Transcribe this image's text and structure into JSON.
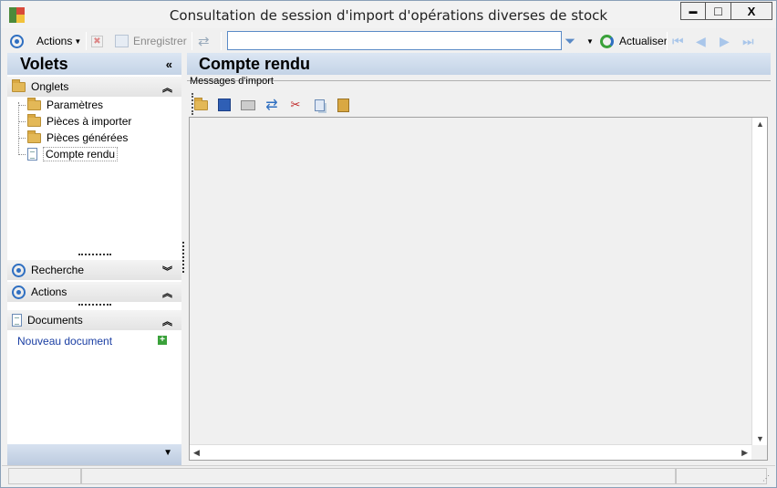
{
  "window": {
    "title": "Consultation de session d'import d'opérations diverses de stock",
    "min_glyph": "▬",
    "max_glyph": "□",
    "close_glyph": "X"
  },
  "toolbar": {
    "actions_label": "Actions",
    "save_label": "Enregistrer",
    "search_value": "",
    "refresh_label": "Actualiser"
  },
  "left_pane": {
    "title": "Volets",
    "collapse_glyph": "«",
    "onglets": {
      "title": "Onglets",
      "items": [
        {
          "label": "Paramètres",
          "icon": "folder-icon"
        },
        {
          "label": "Pièces à importer",
          "icon": "folder-icon"
        },
        {
          "label": "Pièces générées",
          "icon": "folder-icon"
        },
        {
          "label": "Compte rendu",
          "icon": "document-icon"
        }
      ]
    },
    "recherche_title": "Recherche",
    "actions_title": "Actions",
    "documents": {
      "title": "Documents",
      "new_link": "Nouveau document"
    }
  },
  "right_pane": {
    "title": "Compte rendu",
    "tab_label": "Messages d'import"
  },
  "colors": {
    "accent": "#2f6fc1",
    "header_gradient_top": "#dce6f3",
    "header_gradient_bottom": "#c4d3e6",
    "link": "#1a3ea3"
  }
}
